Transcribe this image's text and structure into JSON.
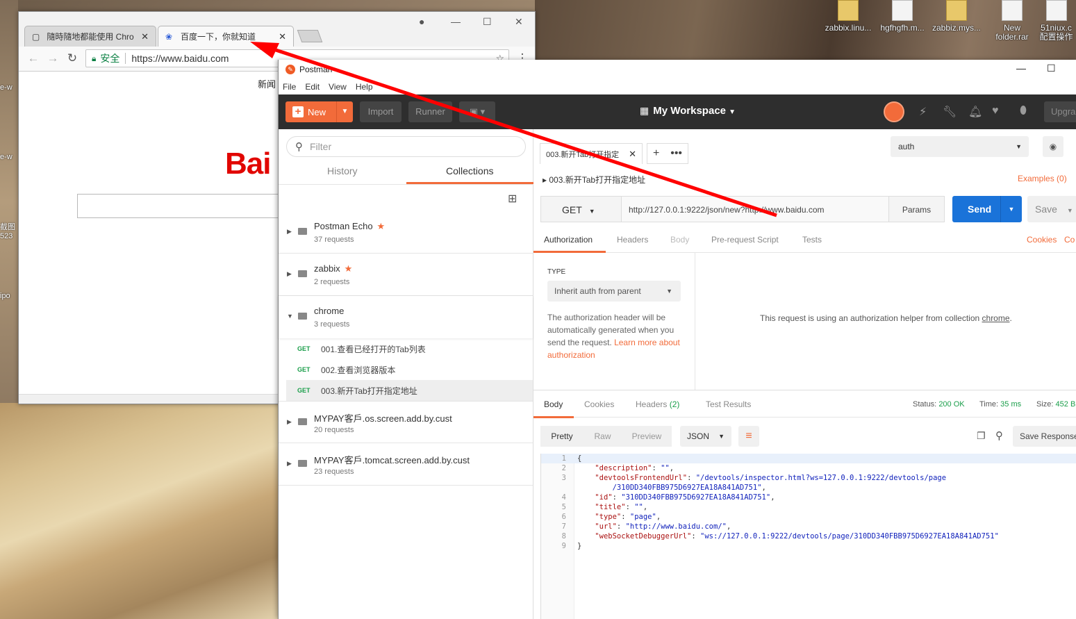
{
  "desktop": {
    "icons": [
      {
        "label": "zabbix.linu..."
      },
      {
        "label": "hgfhgfh.m..."
      },
      {
        "label": "zabbiz.mys..."
      },
      {
        "label": "New folder.rar"
      },
      {
        "label": "51niux.c 配置操作"
      }
    ],
    "left_labels": [
      "e-w",
      "e-w",
      "截图 523",
      "ipo"
    ]
  },
  "chrome": {
    "tabs": [
      {
        "label": "隨時隨地都能使用 Chrom"
      },
      {
        "label": "百度一下，你就知道"
      }
    ],
    "omnibox": {
      "secure_label": "安全",
      "url": "https://www.baidu.com"
    },
    "page": {
      "nav_text": "新闻",
      "logo_text": "Bai"
    }
  },
  "postman": {
    "title": "Postman",
    "menu": [
      "File",
      "Edit",
      "View",
      "Help"
    ],
    "header": {
      "new_label": "New",
      "import_label": "Import",
      "runner_label": "Runner",
      "workspace_label": "My Workspace",
      "upgrade_label": "Upgra"
    },
    "sidebar": {
      "filter_placeholder": "Filter",
      "tabs": [
        "History",
        "Collections"
      ],
      "collections": [
        {
          "name": "Postman Echo",
          "count": "37 requests",
          "starred": true
        },
        {
          "name": "zabbix",
          "count": "2 requests",
          "starred": true
        },
        {
          "name": "chrome",
          "count": "3 requests",
          "starred": false
        },
        {
          "name": "MYPAY客戶.os.screen.add.by.cust",
          "count": "20 requests",
          "starred": false
        },
        {
          "name": "MYPAY客戶.tomcat.screen.add.by.cust",
          "count": "23 requests",
          "starred": false
        }
      ],
      "requests": [
        {
          "method": "GET",
          "name": "001.查看已经打开的Tab列表"
        },
        {
          "method": "GET",
          "name": "002.查看浏览器版本"
        },
        {
          "method": "GET",
          "name": "003.新开Tab打开指定地址"
        }
      ]
    },
    "request_tab": {
      "label": "003.新开Tab打开指定"
    },
    "environment": {
      "selected": "auth"
    },
    "breadcrumb": "003.新开Tab打开指定地址",
    "examples_label": "Examples (0)",
    "method": "GET",
    "url": "http://127.0.0.1:9222/json/new?http://www.baidu.com",
    "params_label": "Params",
    "send_label": "Send",
    "save_label": "Save",
    "request_tabs": [
      "Authorization",
      "Headers",
      "Body",
      "Pre-request Script",
      "Tests"
    ],
    "cookies_label": "Cookies",
    "code_label": "Co",
    "auth": {
      "type_label": "TYPE",
      "type_value": "Inherit auth from parent",
      "note": "The authorization header will be automatically generated when you send the request.",
      "learn_more": "Learn more about authorization",
      "message_prefix": "This request is using an authorization helper from collection",
      "message_collection": "chrome",
      "message_suffix": "."
    },
    "response": {
      "tabs": [
        "Body",
        "Cookies",
        "Headers",
        "Test Results"
      ],
      "headers_count": "(2)",
      "status_label": "Status:",
      "status_value": "200 OK",
      "time_label": "Time:",
      "time_value": "35 ms",
      "size_label": "Size:",
      "size_value": "452 B",
      "views": [
        "Pretty",
        "Raw",
        "Preview"
      ],
      "format": "JSON",
      "save_response_label": "Save Response",
      "code_lines": [
        {
          "n": "1",
          "text": "{"
        },
        {
          "n": "2",
          "key": "\"description\"",
          "val": "\"\"",
          "end": ","
        },
        {
          "n": "3",
          "key": "\"devtoolsFrontendUrl\"",
          "val": "\"/devtools/inspector.html?ws=127.0.0.1:9222/devtools/page",
          "end": ""
        },
        {
          "n": "",
          "key": "",
          "val": "/310DD340FBB975D6927EA18A841AD751\"",
          "end": ","
        },
        {
          "n": "4",
          "key": "\"id\"",
          "val": "\"310DD340FBB975D6927EA18A841AD751\"",
          "end": ","
        },
        {
          "n": "5",
          "key": "\"title\"",
          "val": "\"\"",
          "end": ","
        },
        {
          "n": "6",
          "key": "\"type\"",
          "val": "\"page\"",
          "end": ","
        },
        {
          "n": "7",
          "key": "\"url\"",
          "val": "\"http://www.baidu.com/\"",
          "end": ","
        },
        {
          "n": "8",
          "key": "\"webSocketDebuggerUrl\"",
          "val": "\"ws://127.0.0.1:9222/devtools/page/310DD340FBB975D6927EA18A841AD751\"",
          "end": ""
        },
        {
          "n": "9",
          "text": "}"
        }
      ]
    }
  },
  "colors": {
    "postman_orange": "#f26b3a",
    "send_blue": "#1a73d9",
    "ok_green": "#1a9e4a",
    "annotation_arrow": "#ff0000"
  }
}
